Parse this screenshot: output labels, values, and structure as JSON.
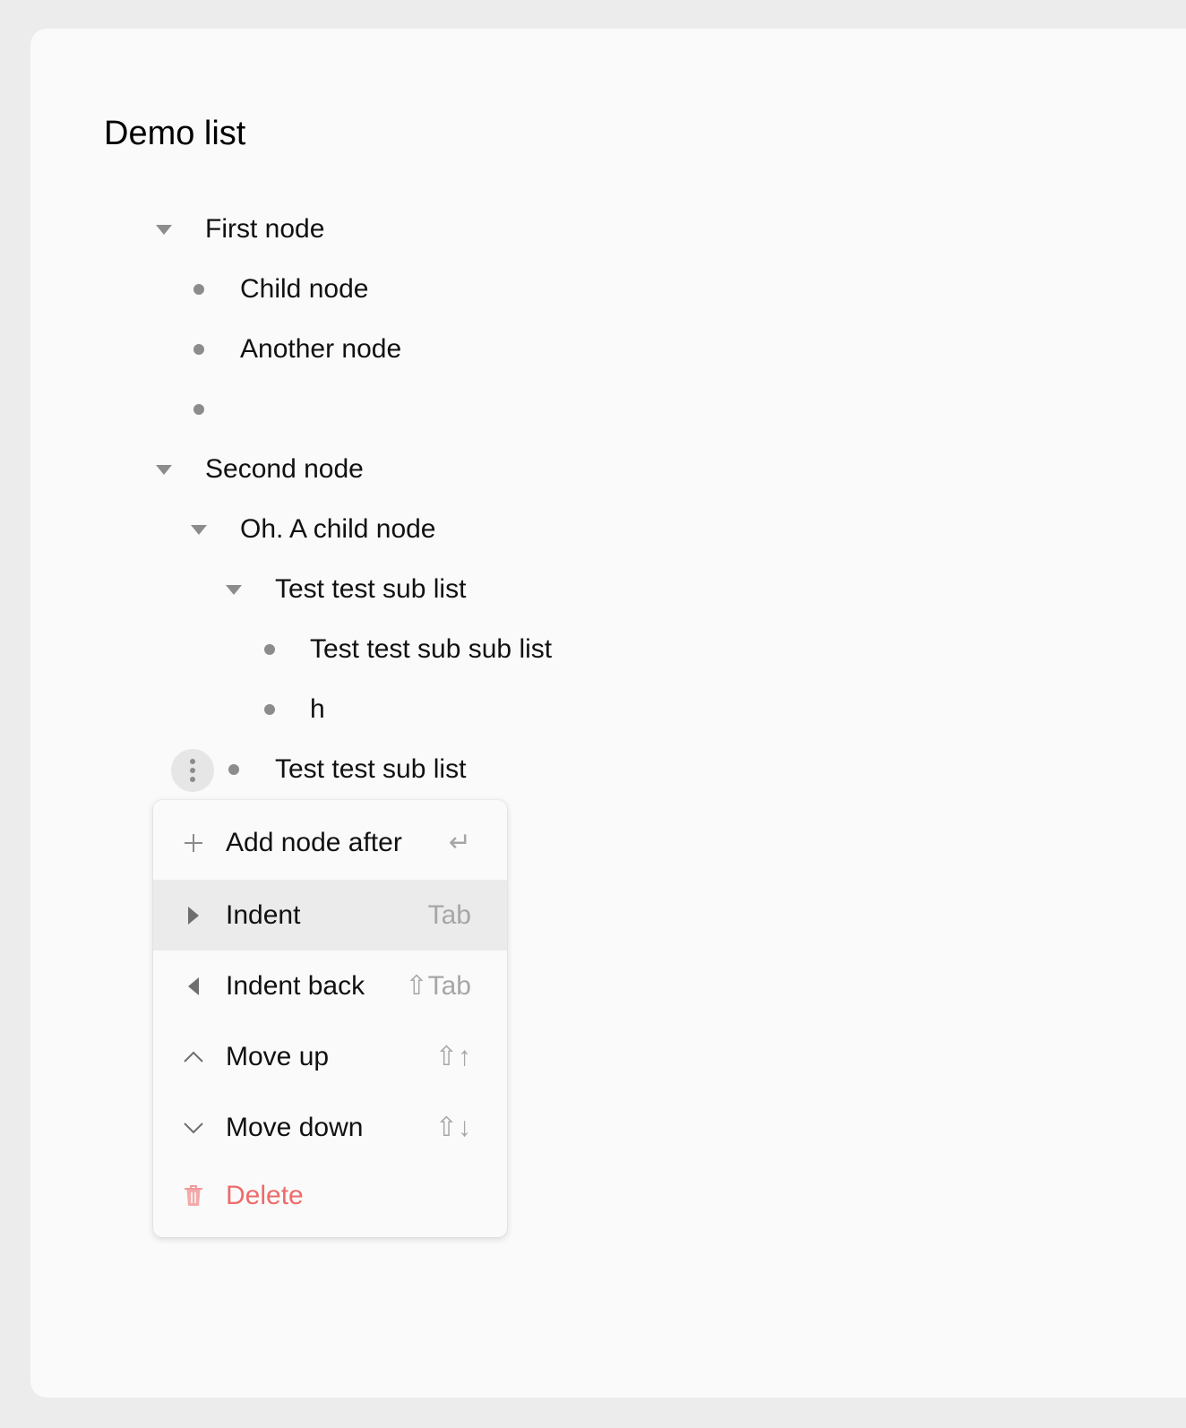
{
  "page": {
    "title": "Demo list"
  },
  "tree": {
    "nodes": [
      {
        "text": "First node",
        "marker": "caret-down-icon"
      },
      {
        "text": "Child node",
        "marker": "bullet-dot-icon"
      },
      {
        "text": "Another node",
        "marker": "bullet-dot-icon"
      },
      {
        "text": "",
        "marker": "bullet-dot-icon"
      },
      {
        "text": "Second node",
        "marker": "caret-down-icon"
      },
      {
        "text": "Oh. A child node",
        "marker": "caret-down-icon"
      },
      {
        "text": "Test test sub list",
        "marker": "caret-down-icon"
      },
      {
        "text": "Test test sub sub list",
        "marker": "bullet-dot-icon"
      },
      {
        "text": "h",
        "marker": "bullet-dot-icon"
      },
      {
        "text": "Test test sub list",
        "marker": "bullet-dot-icon"
      }
    ],
    "row_handle_icon": "more-vertical-icon"
  },
  "context_menu": {
    "items": [
      {
        "label": "Add node after",
        "icon": "plus-icon",
        "shortcut": "↵",
        "state": "normal"
      },
      {
        "label": "Indent",
        "icon": "triangle-right-icon",
        "shortcut": "Tab",
        "state": "highlighted"
      },
      {
        "label": "Indent back",
        "icon": "triangle-left-icon",
        "shortcut": "⇧Tab",
        "state": "normal"
      },
      {
        "label": "Move up",
        "icon": "chevron-up-icon",
        "shortcut": "⇧↑",
        "state": "normal"
      },
      {
        "label": "Move down",
        "icon": "chevron-down-icon",
        "shortcut": "⇧↓",
        "state": "normal"
      },
      {
        "label": "Delete",
        "icon": "trash-icon",
        "shortcut": "",
        "state": "danger"
      }
    ]
  },
  "colors": {
    "page_background": "#ececec",
    "card_background": "#fafafa",
    "marker_gray": "#8c8c8c",
    "shortcut_gray": "#a6a6a6",
    "highlight_row": "#ebebeb",
    "danger": "#ee6b6b"
  }
}
